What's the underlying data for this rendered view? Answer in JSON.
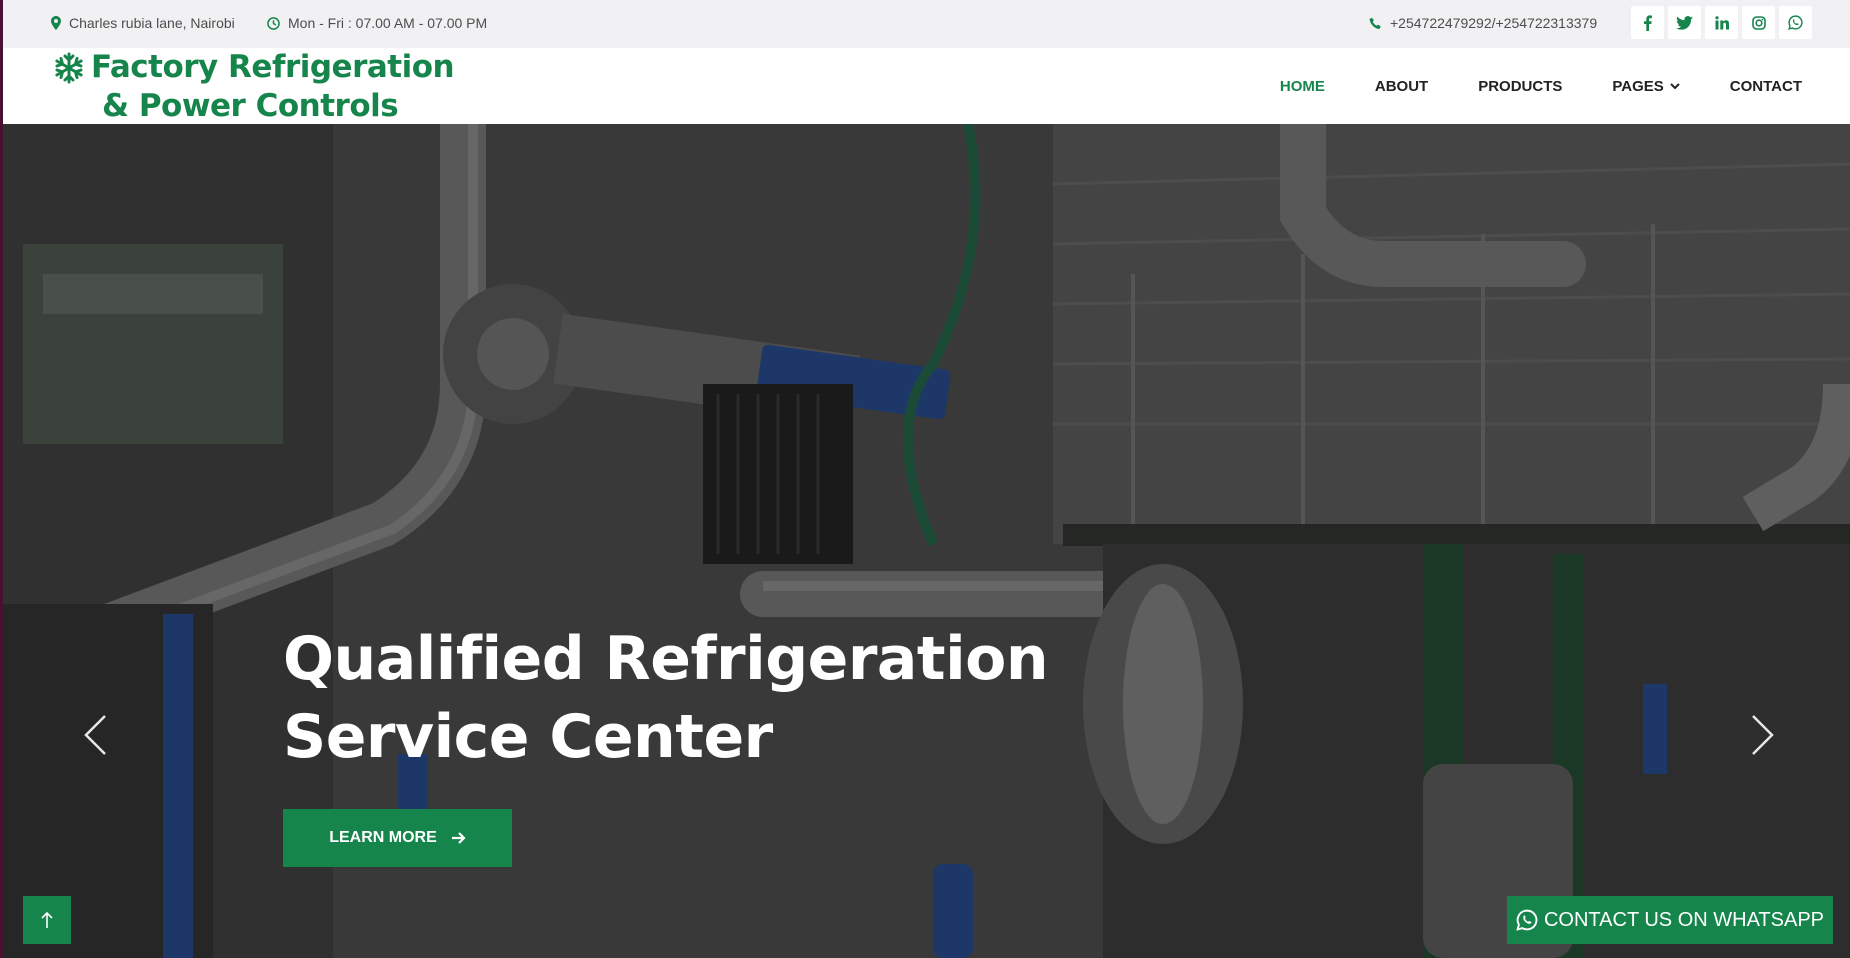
{
  "topbar": {
    "address": "Charles rubia lane, Nairobi",
    "hours": "Mon - Fri : 07.00 AM - 07.00 PM",
    "phone": "+254722479292/+254722313379",
    "socials": [
      "facebook-icon",
      "twitter-icon",
      "linkedin-icon",
      "instagram-icon",
      "whatsapp-icon"
    ]
  },
  "brand": {
    "line1": "Factory Refrigeration",
    "line2": "& Power Controls",
    "color": "#16854c"
  },
  "nav": {
    "items": [
      "HOME",
      "ABOUT",
      "PRODUCTS",
      "PAGES",
      "CONTACT"
    ],
    "active": "HOME"
  },
  "hero": {
    "title_line1": "Qualified Refrigeration",
    "title_line2": "Service Center",
    "button": "LEARN MORE"
  },
  "floating": {
    "whatsapp": "CONTACT US ON WHATSAPP"
  }
}
